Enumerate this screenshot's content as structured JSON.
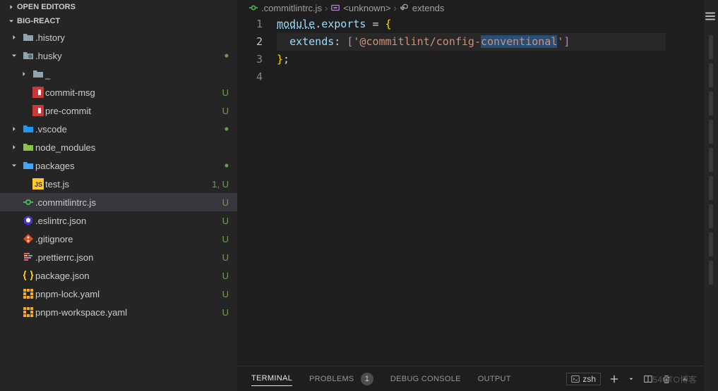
{
  "sidebar": {
    "sections": [
      {
        "label": "OPEN EDITORS",
        "expanded": false
      },
      {
        "label": "BIG-REACT",
        "expanded": true
      }
    ],
    "tree": [
      {
        "depth": 0,
        "kind": "folder",
        "icon": "folder-ico",
        "label": ".history",
        "chev": "right"
      },
      {
        "depth": 0,
        "kind": "folder",
        "icon": "folder-husky",
        "label": ".husky",
        "chev": "down",
        "dot": true
      },
      {
        "depth": 1,
        "kind": "folder",
        "icon": "folder-ico",
        "label": "_",
        "chev": "right"
      },
      {
        "depth": 1,
        "kind": "file",
        "icon": "file-npm",
        "label": "commit-msg",
        "badge": "U"
      },
      {
        "depth": 1,
        "kind": "file",
        "icon": "file-npm",
        "label": "pre-commit",
        "badge": "U"
      },
      {
        "depth": 0,
        "kind": "folder",
        "icon": "folder-vscode",
        "label": ".vscode",
        "chev": "right",
        "dot": true
      },
      {
        "depth": 0,
        "kind": "folder",
        "icon": "folder-node",
        "label": "node_modules",
        "chev": "right"
      },
      {
        "depth": 0,
        "kind": "folder",
        "icon": "folder-pkg",
        "label": "packages",
        "chev": "down",
        "dot": true
      },
      {
        "depth": 1,
        "kind": "file",
        "icon": "file-js",
        "label": "test.js",
        "badge": "1, U"
      },
      {
        "depth": 0,
        "kind": "file",
        "icon": "file-commit",
        "label": ".commitlintrc.js",
        "badge": "U",
        "active": true
      },
      {
        "depth": 0,
        "kind": "file",
        "icon": "file-eslint",
        "label": ".eslintrc.json",
        "badge": "U"
      },
      {
        "depth": 0,
        "kind": "file",
        "icon": "file-git",
        "label": ".gitignore",
        "badge": "U"
      },
      {
        "depth": 0,
        "kind": "file",
        "icon": "file-prettier",
        "label": ".prettierrc.json",
        "badge": "U"
      },
      {
        "depth": 0,
        "kind": "file",
        "icon": "file-json",
        "label": "package.json",
        "badge": "U"
      },
      {
        "depth": 0,
        "kind": "file",
        "icon": "file-pnpm",
        "label": "pnpm-lock.yaml",
        "badge": "U"
      },
      {
        "depth": 0,
        "kind": "file",
        "icon": "file-pnpm",
        "label": "pnpm-workspace.yaml",
        "badge": "U"
      }
    ]
  },
  "breadcrumb": {
    "items": [
      {
        "icon": "file-commit",
        "label": ".commitlintrc.js"
      },
      {
        "icon": "symbol-module",
        "label": "<unknown>"
      },
      {
        "icon": "symbol-key",
        "label": "extends"
      }
    ]
  },
  "editor": {
    "lines": [
      "1",
      "2",
      "3",
      "4"
    ],
    "currentLine": 2,
    "code": {
      "l1": {
        "module": "module",
        "dot": ".",
        "exports": "exports",
        "eq": " = ",
        "brace": "{"
      },
      "l2": {
        "indent": "  ",
        "key": "extends",
        "colon": ": ",
        "lbracket": "[",
        "str_open": "'",
        "str_body": "@commitlint/config-",
        "str_sel": "conventional",
        "str_close": "'",
        "rbracket": "]"
      },
      "l3": {
        "brace": "}",
        "semi": ";"
      }
    }
  },
  "panel": {
    "tabs": [
      {
        "label": "TERMINAL",
        "active": true
      },
      {
        "label": "PROBLEMS",
        "badge": "1"
      },
      {
        "label": "DEBUG CONSOLE"
      },
      {
        "label": "OUTPUT"
      }
    ],
    "terminal": {
      "shell": "zsh"
    }
  },
  "watermark": "54CTO博客"
}
